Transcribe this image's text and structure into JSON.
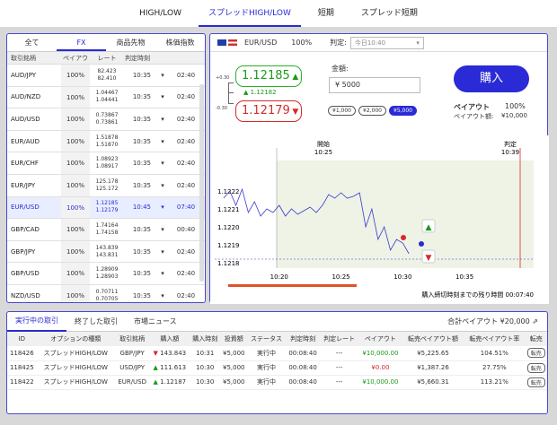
{
  "topnav": {
    "tabs": [
      {
        "label": "HIGH/LOW"
      },
      {
        "label": "スプレッドHIGH/LOW"
      },
      {
        "label": "短期"
      },
      {
        "label": "スプレッド短期"
      }
    ]
  },
  "left": {
    "tabs": [
      "全て",
      "FX",
      "商品先物",
      "株価指数"
    ],
    "headers": [
      "取引銘柄",
      "ペイアウト",
      "レート",
      "判定時刻",
      "",
      ""
    ],
    "rows": [
      {
        "pair": "AUD/JPY",
        "payout": "100%",
        "rate_hi": "82.423",
        "rate_lo": "82.410",
        "time": "10:35",
        "remain": "02:40"
      },
      {
        "pair": "AUD/NZD",
        "payout": "100%",
        "rate_hi": "1.04467",
        "rate_lo": "1.04441",
        "time": "10:35",
        "remain": "02:40"
      },
      {
        "pair": "AUD/USD",
        "payout": "100%",
        "rate_hi": "0.73867",
        "rate_lo": "0.73861",
        "time": "10:35",
        "remain": "02:40"
      },
      {
        "pair": "EUR/AUD",
        "payout": "100%",
        "rate_hi": "1.51878",
        "rate_lo": "1.51870",
        "time": "10:35",
        "remain": "02:40"
      },
      {
        "pair": "EUR/CHF",
        "payout": "100%",
        "rate_hi": "1.08923",
        "rate_lo": "1.08917",
        "time": "10:35",
        "remain": "02:40"
      },
      {
        "pair": "EUR/JPY",
        "payout": "100%",
        "rate_hi": "125.178",
        "rate_lo": "125.172",
        "time": "10:35",
        "remain": "02:40"
      },
      {
        "pair": "EUR/USD",
        "payout": "100%",
        "rate_hi": "1.12185",
        "rate_lo": "1.12179",
        "time": "10:45",
        "remain": "07:40"
      },
      {
        "pair": "GBP/CAD",
        "payout": "100%",
        "rate_hi": "1.74164",
        "rate_lo": "1.74158",
        "time": "10:35",
        "remain": "00:40"
      },
      {
        "pair": "GBP/JPY",
        "payout": "100%",
        "rate_hi": "143.839",
        "rate_lo": "143.831",
        "time": "10:35",
        "remain": "02:40"
      },
      {
        "pair": "GBP/USD",
        "payout": "100%",
        "rate_hi": "1.28909",
        "rate_lo": "1.28903",
        "time": "10:35",
        "remain": "02:40"
      },
      {
        "pair": "NZD/USD",
        "payout": "100%",
        "rate_hi": "0.70711",
        "rate_lo": "0.70705",
        "time": "10:35",
        "remain": "02:40"
      }
    ]
  },
  "right": {
    "pair": "EUR/USD",
    "payout_pct": "100%",
    "judge_label": "判定:",
    "judge_time": "今日10:40",
    "scale_top": "+0.30",
    "scale_bot": "-0.30",
    "high_rate": "1.12185",
    "high_sub": "1.12182",
    "low_rate": "1.12179",
    "amount_label": "金額:",
    "amount_value": "¥ 5000",
    "preset": [
      "¥1,000",
      "¥2,000",
      "¥5,000"
    ],
    "buy_label": "購入",
    "payout_label": "ペイアウト",
    "payout_value": "100%",
    "payout_amount_label": "ペイアウト額:",
    "payout_amount": "¥10,000",
    "chart": {
      "start_label": "開始",
      "start_time": "10:25",
      "judge_label": "判定",
      "judge_time": "10:39",
      "remain_text": "購入締切時刻までの残り時間 00:07:40"
    }
  },
  "chart_data": {
    "type": "line",
    "title": "",
    "ylim": [
      1.1217,
      1.1223
    ],
    "yticks": [
      "1.1222",
      "1.1221",
      "1.1220",
      "1.1219",
      "1.1218"
    ],
    "xticks": [
      "10:20",
      "10:25",
      "10:30",
      "10:35"
    ],
    "series": [
      {
        "x": [
          "10:15:30",
          "10:16:00",
          "10:16:30",
          "10:17:00",
          "10:17:30",
          "10:18:00",
          "10:18:30",
          "10:19:00",
          "10:19:30",
          "10:20:00",
          "10:20:30",
          "10:21:00",
          "10:21:30",
          "10:22:00",
          "10:22:30",
          "10:23:00",
          "10:23:30",
          "10:24:00",
          "10:24:30",
          "10:25:00",
          "10:25:30",
          "10:26:00",
          "10:26:30",
          "10:27:00",
          "10:27:30",
          "10:28:00",
          "10:28:30",
          "10:29:00",
          "10:29:30",
          "10:30:00",
          "10:30:30"
        ],
        "y": [
          1.12216,
          1.1222,
          1.12212,
          1.12221,
          1.12208,
          1.12214,
          1.12206,
          1.1221,
          1.12208,
          1.12212,
          1.12206,
          1.1221,
          1.12207,
          1.12209,
          1.12211,
          1.12208,
          1.12212,
          1.12218,
          1.12216,
          1.12219,
          1.12216,
          1.12217,
          1.12219,
          1.122,
          1.1221,
          1.12193,
          1.122,
          1.12187,
          1.12193,
          1.12191,
          1.12185
        ]
      }
    ],
    "reference_level": 1.12182
  },
  "bottom": {
    "tabs": [
      "実行中の取引",
      "終了した取引",
      "市場ニュース"
    ],
    "total_label": "合計ペイアウト",
    "total_value": "¥20,000",
    "headers": [
      "ID",
      "オプションの種類",
      "取引銘柄",
      "購入額",
      "購入時刻",
      "投資額",
      "ステータス",
      "判定時刻",
      "判定レート",
      "ペイアウト",
      "転売ペイアウト額",
      "転売ペイアウト率",
      "転売"
    ],
    "rows": [
      {
        "id": "118426",
        "type": "スプレッドHIGH/LOW",
        "pair": "GBP/JPY",
        "dir": "down",
        "price": "143.843",
        "time": "10:31",
        "invest": "¥5,000",
        "status": "実行中",
        "judge": "00:08:40",
        "jrate": "---",
        "payout": "¥10,000.00",
        "resale": "¥5,225.65",
        "rate": "104.51%",
        "btn": "転売"
      },
      {
        "id": "118425",
        "type": "スプレッドHIGH/LOW",
        "pair": "USD/JPY",
        "dir": "up",
        "price": "111.613",
        "time": "10:30",
        "invest": "¥5,000",
        "status": "実行中",
        "judge": "00:08:40",
        "jrate": "---",
        "payout": "¥0.00",
        "resale": "¥1,387.26",
        "rate": "27.75%",
        "btn": "転売"
      },
      {
        "id": "118422",
        "type": "スプレッドHIGH/LOW",
        "pair": "EUR/USD",
        "dir": "up",
        "price": "1.12187",
        "time": "10:30",
        "invest": "¥5,000",
        "status": "実行中",
        "judge": "00:08:40",
        "jrate": "---",
        "payout": "¥10,000.00",
        "resale": "¥5,660.31",
        "rate": "113.21%",
        "btn": "転売"
      }
    ]
  }
}
